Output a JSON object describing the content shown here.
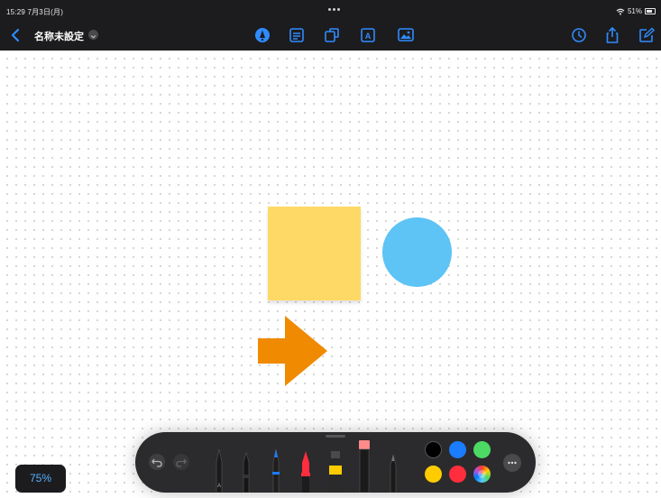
{
  "status_bar": {
    "time_date": "15:29  7月3日(月)",
    "battery_text": "51%"
  },
  "toolbar": {
    "title": "名称未設定",
    "icons": [
      "back-chevron-icon",
      "pen-tool-icon",
      "text-box-icon",
      "shapes-icon",
      "text-icon",
      "media-icon",
      "history-icon",
      "share-icon",
      "new-board-icon"
    ]
  },
  "canvas": {
    "shapes": [
      {
        "type": "sticky-note",
        "color": "#ffd966"
      },
      {
        "type": "circle",
        "color": "#5ec3f5"
      },
      {
        "type": "arrow",
        "color": "#f08a00"
      }
    ]
  },
  "palette": {
    "tools": [
      "pen",
      "marker",
      "fountain-pen",
      "crayon",
      "highlighter",
      "pencil",
      "ruler-pen"
    ],
    "colors": [
      "#000000",
      "#1a7cff",
      "#4cd964",
      "#ffcc00",
      "#ff2d3d",
      "color-wheel"
    ]
  },
  "zoom": {
    "label": "75%"
  }
}
